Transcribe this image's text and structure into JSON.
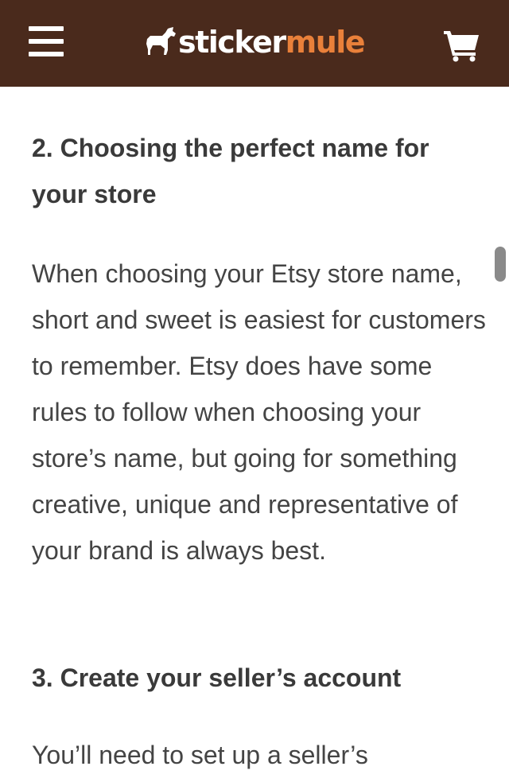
{
  "header": {
    "logo": {
      "word_sticker": "sticker",
      "word_mule": "mule"
    },
    "menu_icon": "hamburger-menu-icon",
    "cart_icon": "shopping-cart-icon",
    "colors": {
      "header_bg": "#4a2a1c",
      "brand_orange": "#e9803a",
      "logo_white": "#ffffff"
    }
  },
  "article": {
    "section2": {
      "heading": "2. Choosing the perfect name for your store",
      "body": "When choosing your Etsy store name, short and sweet is easiest for customers to remember. Etsy does have some rules to follow when choosing your store’s name, but going for something creative, unique and representative of your brand is always best."
    },
    "section3": {
      "heading": "3. Create your seller’s account",
      "body": "You’ll need to set up a seller’s"
    }
  }
}
